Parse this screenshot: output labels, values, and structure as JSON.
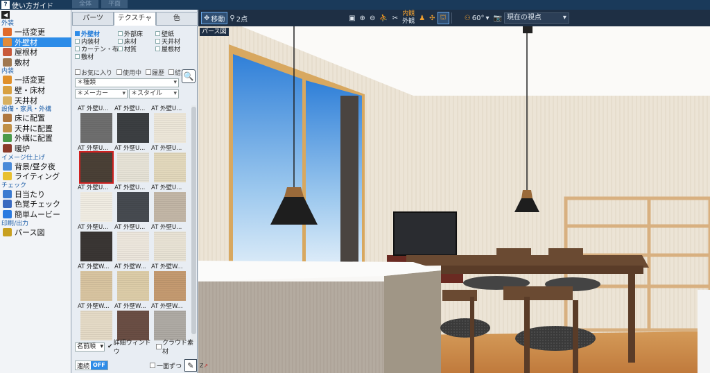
{
  "app": {
    "help_label": "使い方ガイド",
    "ghost_tabs": [
      "全体",
      "平面"
    ]
  },
  "sidebar": {
    "sections": [
      {
        "title": "外装",
        "items": [
          {
            "label": "一括変更",
            "icon": "house-paint-icon",
            "color": "#e06a2a",
            "selected": false
          },
          {
            "label": "外壁材",
            "icon": "wall-icon",
            "color": "#e08a3a",
            "selected": true
          },
          {
            "label": "屋根材",
            "icon": "roof-icon",
            "color": "#c85a3a",
            "selected": false
          },
          {
            "label": "敷材",
            "icon": "paving-icon",
            "color": "#a07850",
            "selected": false
          }
        ]
      },
      {
        "title": "内装",
        "items": [
          {
            "label": "一括変更",
            "icon": "room-paint-icon",
            "color": "#e0902a",
            "selected": false
          },
          {
            "label": "壁・床材",
            "icon": "floor-icon",
            "color": "#d8a040",
            "selected": false
          },
          {
            "label": "天井材",
            "icon": "ceiling-icon",
            "color": "#d8b060",
            "selected": false
          }
        ]
      },
      {
        "title": "設備・家具・外構",
        "items": [
          {
            "label": "床に配置",
            "icon": "floor-place-icon",
            "color": "#b07840",
            "selected": false
          },
          {
            "label": "天井に配置",
            "icon": "ceiling-place-icon",
            "color": "#c09048",
            "selected": false
          },
          {
            "label": "外構に配置",
            "icon": "exterior-place-icon",
            "color": "#4a9a4a",
            "selected": false
          },
          {
            "label": "暖炉",
            "icon": "fireplace-icon",
            "color": "#8a3a2a",
            "selected": false
          }
        ]
      },
      {
        "title": "イメージ仕上げ",
        "items": [
          {
            "label": "背景/昼夕夜",
            "icon": "background-icon",
            "color": "#4a8ad8",
            "selected": false
          },
          {
            "label": "ライティング",
            "icon": "bulb-icon",
            "color": "#e8c030",
            "selected": false
          }
        ]
      },
      {
        "title": "チェック",
        "items": [
          {
            "label": "日当たり",
            "icon": "sun-icon",
            "color": "#3a7ad0",
            "selected": false
          },
          {
            "label": "色覚チェック",
            "icon": "eye-icon",
            "color": "#3a6ac0",
            "selected": false
          },
          {
            "label": "簡単ムービー",
            "icon": "movie-icon",
            "color": "#2a7ae0",
            "selected": false
          }
        ]
      },
      {
        "title": "印刷/出力",
        "items": [
          {
            "label": "パース図",
            "icon": "print-icon",
            "color": "#c8a020",
            "selected": false
          }
        ]
      }
    ]
  },
  "panel": {
    "tabs": [
      {
        "label": "パーツ",
        "active": false
      },
      {
        "label": "テクスチャ",
        "active": true
      },
      {
        "label": "色",
        "active": false
      }
    ],
    "categories": [
      {
        "label": "外壁材",
        "active": true
      },
      {
        "label": "外部床",
        "active": false
      },
      {
        "label": "壁紙",
        "active": false
      },
      {
        "label": "内装材",
        "active": false
      },
      {
        "label": "床材",
        "active": false
      },
      {
        "label": "天井材",
        "active": false
      },
      {
        "label": "カーテン・布",
        "active": false
      },
      {
        "label": "材質",
        "active": false
      },
      {
        "label": "屋根材",
        "active": false
      },
      {
        "label": "敷材",
        "active": false
      }
    ],
    "filters": [
      "お気に入り",
      "使用中",
      "履歴",
      "結果"
    ],
    "type_select": "＊種類",
    "maker_select": "＊メーカー",
    "style_select": "＊スタイル",
    "tiles": [
      {
        "label": "AT 外壁U...",
        "color": "#6e6e6e",
        "selected": false
      },
      {
        "label": "AT 外壁U...",
        "color": "#3c3f42",
        "selected": false
      },
      {
        "label": "AT 外壁U...",
        "color": "#ece6d8",
        "selected": false
      },
      {
        "label": "AT 外壁U...",
        "color": "#4a4036",
        "selected": true
      },
      {
        "label": "AT 外壁U...",
        "color": "#e6e2d6",
        "selected": false
      },
      {
        "label": "AT 外壁U...",
        "color": "#e2d8bc",
        "selected": false
      },
      {
        "label": "AT 外壁U...",
        "color": "#f0ece2",
        "selected": false
      },
      {
        "label": "AT 外壁U...",
        "color": "#464a50",
        "selected": false
      },
      {
        "label": "AT 外壁U...",
        "color": "#c2b6a6",
        "selected": false
      },
      {
        "label": "AT 外壁U...",
        "color": "#3a3634",
        "selected": false
      },
      {
        "label": "AT 外壁U...",
        "color": "#ece6dc",
        "selected": false
      },
      {
        "label": "AT 外壁U...",
        "color": "#e8e2d4",
        "selected": false
      },
      {
        "label": "AT 外壁W...",
        "color": "#d8c4a0",
        "selected": false
      },
      {
        "label": "AT 外壁W...",
        "color": "#dccca8",
        "selected": false
      },
      {
        "label": "AT 外壁W...",
        "color": "#c49a70",
        "selected": false
      },
      {
        "label": "AT 外壁W...",
        "color": "#e4dac6",
        "selected": false
      },
      {
        "label": "AT 外壁W...",
        "color": "#6a4e44",
        "selected": false
      },
      {
        "label": "AT 外壁W...",
        "color": "#aeaaa4",
        "selected": false
      }
    ],
    "sort_select": "名前順",
    "detail_window": "詳細ウィンドウ",
    "cloud_material": "クラウド素材",
    "renzoku": "連続",
    "renzoku_state": "OFF",
    "ichimen": "一面ずつ"
  },
  "toolbar": {
    "move": "移動",
    "two_point": "2点",
    "inner_outer_top": "内観",
    "inner_outer_bottom": "外観",
    "angle": "60°",
    "view_select": "現在の視点"
  },
  "view": {
    "label": "パース図",
    "axis": "Z"
  }
}
